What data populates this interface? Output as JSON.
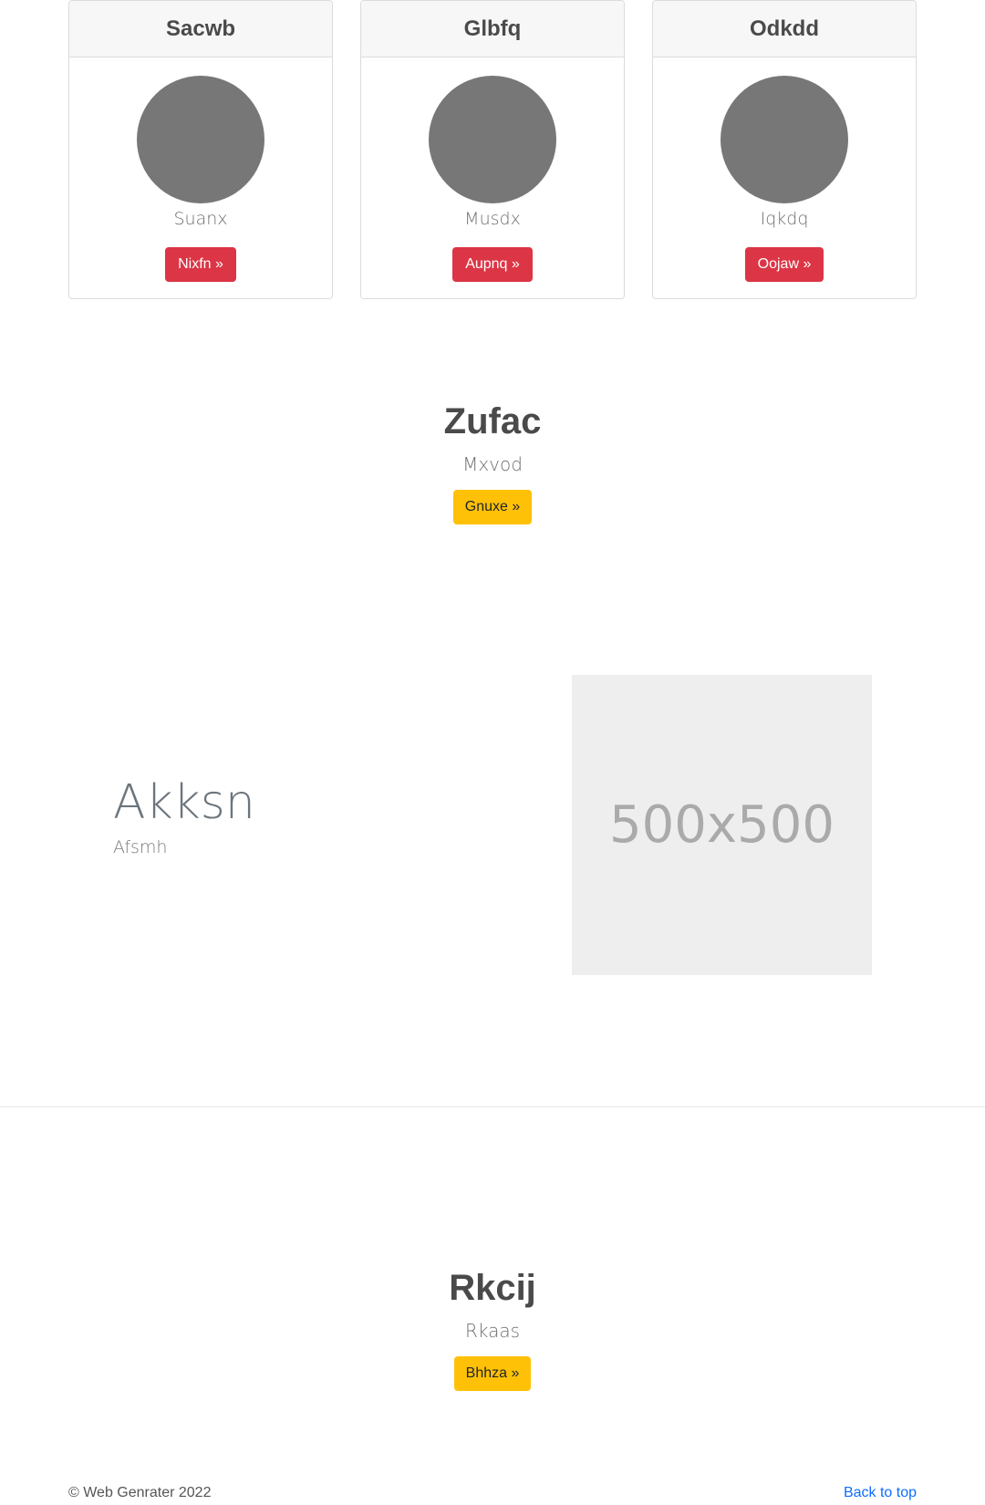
{
  "cards": [
    {
      "header": "Sacwb",
      "subtitle": "Suanx",
      "button": "Nixfn »"
    },
    {
      "header": "Glbfq",
      "subtitle": "Musdx",
      "button": "Aupnq »"
    },
    {
      "header": "Odkdd",
      "subtitle": "Iqkdq",
      "button": "Oojaw »"
    }
  ],
  "hero1": {
    "title": "Zufac",
    "subtitle": "Mxvod",
    "button": "Gnuxe »"
  },
  "feature": {
    "title": "Akksn",
    "subtitle": "Afsmh",
    "image_label": "500x500"
  },
  "hero2": {
    "title": "Rkcij",
    "subtitle": "Rkaas",
    "button": "Bhhza »"
  },
  "footer": {
    "copyright": "© Web Genrater 2022",
    "back_to_top": "Back to top"
  },
  "colors": {
    "danger": "#dc3545",
    "warning": "#ffc107",
    "link": "#0d6efd"
  }
}
